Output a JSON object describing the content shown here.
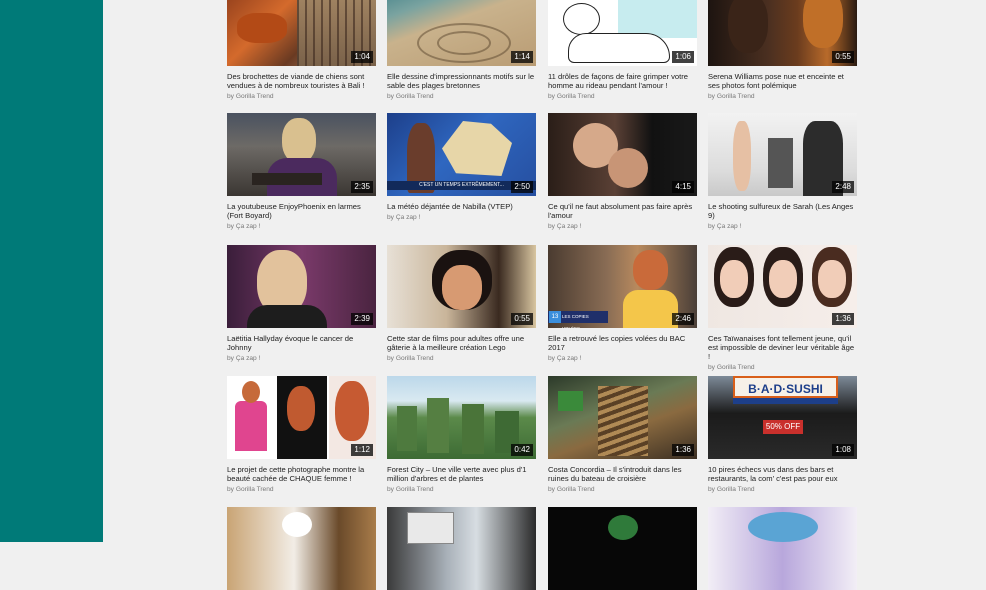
{
  "by_prefix": "by",
  "colors": {
    "sidebar": "#007a78",
    "background": "#f0f0f0"
  },
  "rows": [
    [
      {
        "title": "Des brochettes de viande de chiens sont vendues à de nombreux touristes à Bali !",
        "duration": "1:04",
        "channel": "Gorilla Trend"
      },
      {
        "title": "Elle dessine d'impressionnants motifs sur le sable des plages bretonnes",
        "duration": "1:14",
        "channel": "Gorilla Trend"
      },
      {
        "title": "11 drôles de façons de faire grimper votre homme au rideau pendant l'amour !",
        "duration": "1:06",
        "channel": "Gorilla Trend"
      },
      {
        "title": "Serena Williams pose nue et enceinte et ses photos font polémique",
        "duration": "0:55",
        "channel": "Gorilla Trend"
      }
    ],
    [
      {
        "title": "La youtubeuse EnjoyPhoenix en larmes (Fort Boyard)",
        "duration": "2:35",
        "channel": "Ça zap !"
      },
      {
        "title": "La météo déjantée de Nabilla (VTEP)",
        "duration": "2:50",
        "channel": "Ça zap !"
      },
      {
        "title": "Ce qu'il ne faut absolument pas faire après l'amour",
        "duration": "4:15",
        "channel": "Ça zap !"
      },
      {
        "title": "Le shooting sulfureux de Sarah (Les Anges 9)",
        "duration": "2:48",
        "channel": "Ça zap !"
      }
    ],
    [
      {
        "title": "Laëtitia Hallyday évoque le cancer de Johnny",
        "duration": "2:39",
        "channel": "Ça zap !"
      },
      {
        "title": "Cette star de films pour adultes offre une gâterie à la meilleure création Lego",
        "duration": "0:55",
        "channel": "Gorilla Trend"
      },
      {
        "title": "Elle a retrouvé les copies volées du BAC 2017",
        "duration": "2:46",
        "channel": "Ça zap !"
      },
      {
        "title": "Ces Taïwanaises font tellement jeune, qu'il est impossible de deviner leur véritable âge !",
        "duration": "1:36",
        "channel": "Gorilla Trend"
      }
    ],
    [
      {
        "title": "Le projet de cette photographe montre la beauté cachée de CHAQUE femme !",
        "duration": "1:12",
        "channel": "Gorilla Trend"
      },
      {
        "title": "Forest City – Une ville verte avec plus d'1 million d'arbres et de plantes",
        "duration": "0:42",
        "channel": "Gorilla Trend"
      },
      {
        "title": "Costa Concordia – Il s'introduit dans les ruines du bateau de croisière",
        "duration": "1:36",
        "channel": "Gorilla Trend"
      },
      {
        "title": "10 pires échecs vus dans des bars et restaurants, la com' c'est pas pour eux",
        "duration": "1:08",
        "channel": "Gorilla Trend"
      }
    ]
  ],
  "thumb_text": {
    "bad_sushi": "B·A·D·SUSHI",
    "discount": "50% OFF",
    "weather_banner": "C'EST UN TEMPS EXTRÊMEMENT...",
    "lower_third": "LES COPIES VOLÉES RETROUVÉES",
    "channel_badge": "13"
  }
}
